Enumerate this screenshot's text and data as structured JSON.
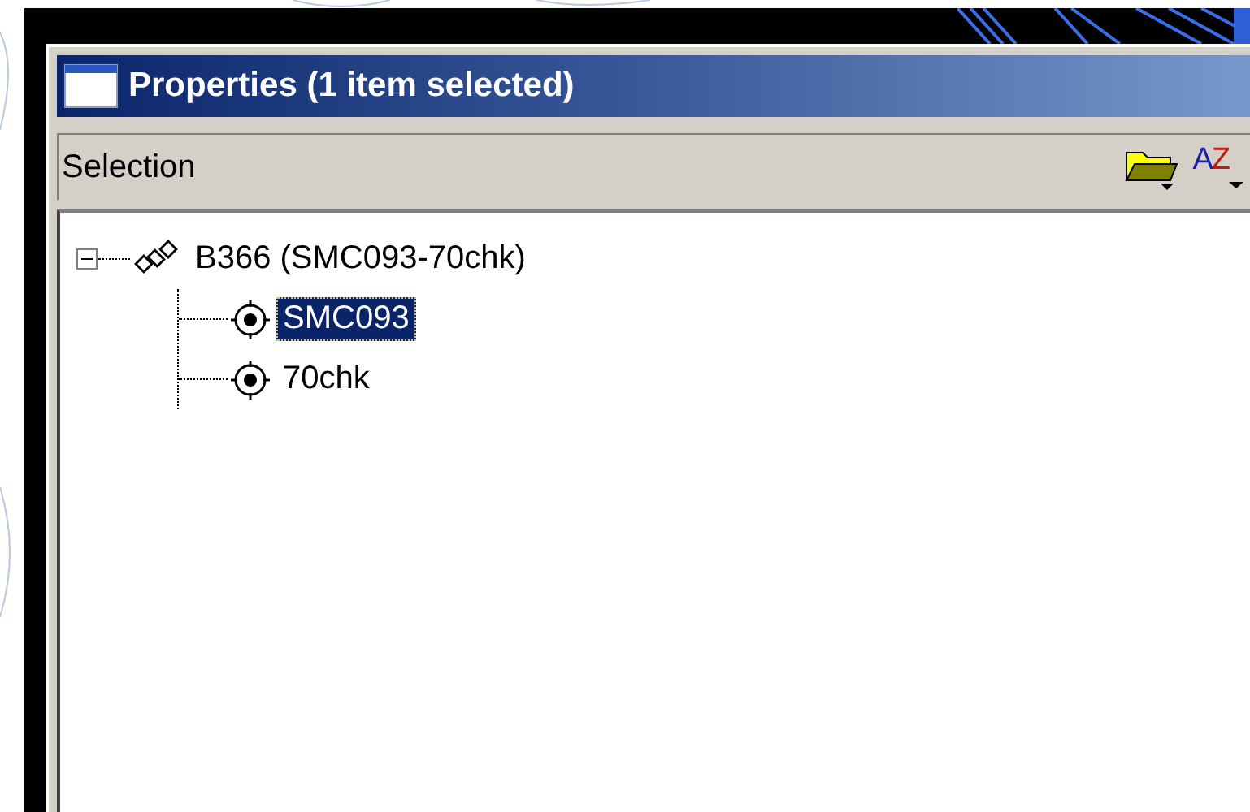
{
  "window": {
    "title": "Properties (1 item selected)"
  },
  "toolbar": {
    "label": "Selection",
    "sort_letters": [
      "A",
      "Z"
    ]
  },
  "tree": [
    {
      "label": "B366 (SMC093-70chk)",
      "kind": "group",
      "expanded": true,
      "selected": false,
      "children": [
        {
          "label": "SMC093",
          "kind": "point",
          "selected": true
        },
        {
          "label": "70chk",
          "kind": "point",
          "selected": false
        }
      ]
    }
  ]
}
